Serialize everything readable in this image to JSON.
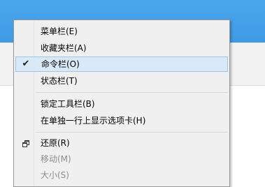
{
  "context_menu": {
    "items": [
      {
        "label": "菜单栏(E)"
      },
      {
        "label": "收藏夹栏(A)"
      },
      {
        "label": "命令栏(O)",
        "checked": true
      },
      {
        "label": "状态栏(T)"
      },
      {
        "label": "锁定工具栏(B)"
      },
      {
        "label": "在单独一行上显示选项卡(H)"
      },
      {
        "label": "还原(R)",
        "icon": "restore-icon"
      },
      {
        "label": "移动(M)",
        "disabled": true
      },
      {
        "label": "大小(S)",
        "disabled": true
      }
    ],
    "check_glyph": "✔",
    "colors": {
      "title_bar": "#3f9ae4",
      "highlight": "#dae9f7",
      "highlight_border": "#99c7ee",
      "disabled_text": "#8d8d8d"
    }
  }
}
